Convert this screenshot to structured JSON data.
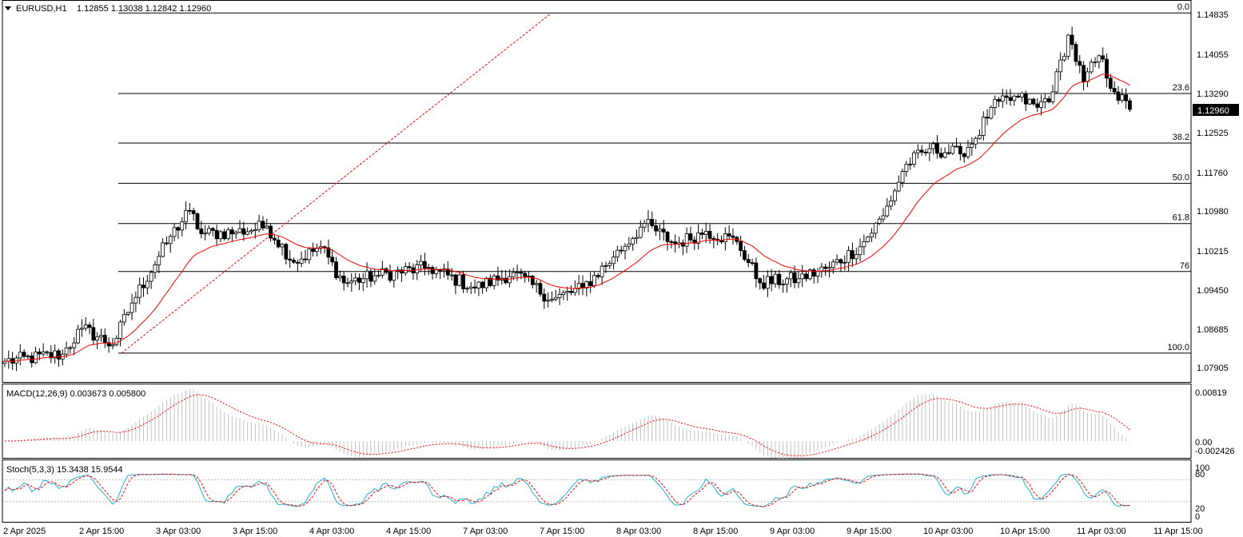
{
  "header": {
    "symbol": "EURUSD,H1",
    "ohlc": "1.12855 1.13038 1.12842 1.12960"
  },
  "price_axis": {
    "labels": [
      "1.14835",
      "1.14055",
      "1.13290",
      "1.12525",
      "1.11760",
      "1.10980",
      "1.10215",
      "1.09450",
      "1.08685",
      "1.07905"
    ],
    "current_price": "1.12960"
  },
  "fibonacci": {
    "levels": [
      {
        "label": "0.0",
        "price": 1.1483
      },
      {
        "label": "23.6",
        "price": 1.1327
      },
      {
        "label": "38.2",
        "price": 1.1231
      },
      {
        "label": "50.0",
        "price": 1.1153
      },
      {
        "label": "61.8",
        "price": 1.1075
      },
      {
        "label": "76",
        "price": 1.0982
      },
      {
        "label": "100.0",
        "price": 1.0824
      }
    ]
  },
  "macd": {
    "title": "MACD(12,26,9) 0.003673 0.005800",
    "axis_labels": [
      "0.00819",
      "0.00",
      "-0.002426"
    ]
  },
  "stochastic": {
    "title": "Stoch(5,3,3) 15.3438 15.9544",
    "axis_labels": [
      "100",
      "80",
      "20",
      "0"
    ]
  },
  "time_axis": {
    "labels": [
      "2 Apr 2025",
      "2 Apr 15:00",
      "3 Apr 03:00",
      "3 Apr 15:00",
      "4 Apr 03:00",
      "4 Apr 15:00",
      "7 Apr 03:00",
      "7 Apr 15:00",
      "8 Apr 03:00",
      "8 Apr 15:00",
      "9 Apr 03:00",
      "9 Apr 15:00",
      "10 Apr 03:00",
      "10 Apr 15:00",
      "11 Apr 03:00",
      "11 Apr 15:00"
    ]
  },
  "colors": {
    "bull_candle": "#ffffff",
    "bear_candle": "#000000",
    "moving_average": "#ff0000",
    "macd_histogram": "#c0c0c0",
    "macd_signal": "#ff0000",
    "stoch_main": "#20b2d0",
    "stoch_signal": "#ff0000",
    "fib_trend_line": "#ff0000"
  },
  "chart_data": {
    "type": "candlestick",
    "symbol": "EURUSD",
    "timeframe": "H1",
    "price_range": [
      1.0768,
      1.1505
    ],
    "close_key_points": [
      {
        "bar": 0,
        "close": 1.0808
      },
      {
        "bar": 15,
        "close": 1.0822
      },
      {
        "bar": 20,
        "close": 1.0872
      },
      {
        "bar": 28,
        "close": 1.084
      },
      {
        "bar": 33,
        "close": 1.0921
      },
      {
        "bar": 43,
        "close": 1.105
      },
      {
        "bar": 48,
        "close": 1.11
      },
      {
        "bar": 51,
        "close": 1.1055
      },
      {
        "bar": 60,
        "close": 1.1058
      },
      {
        "bar": 68,
        "close": 1.107
      },
      {
        "bar": 75,
        "close": 1.1
      },
      {
        "bar": 82,
        "close": 1.103
      },
      {
        "bar": 88,
        "close": 1.096
      },
      {
        "bar": 97,
        "close": 1.0975
      },
      {
        "bar": 110,
        "close": 1.099
      },
      {
        "bar": 122,
        "close": 1.095
      },
      {
        "bar": 132,
        "close": 1.098
      },
      {
        "bar": 142,
        "close": 1.0928
      },
      {
        "bar": 150,
        "close": 1.095
      },
      {
        "bar": 158,
        "close": 1.101
      },
      {
        "bar": 166,
        "close": 1.1075
      },
      {
        "bar": 174,
        "close": 1.1035
      },
      {
        "bar": 182,
        "close": 1.106
      },
      {
        "bar": 190,
        "close": 1.104
      },
      {
        "bar": 196,
        "close": 1.096
      },
      {
        "bar": 206,
        "close": 1.0968
      },
      {
        "bar": 214,
        "close": 1.099
      },
      {
        "bar": 222,
        "close": 1.103
      },
      {
        "bar": 228,
        "close": 1.109
      },
      {
        "bar": 234,
        "close": 1.119
      },
      {
        "bar": 240,
        "close": 1.122
      },
      {
        "bar": 248,
        "close": 1.121
      },
      {
        "bar": 252,
        "close": 1.124
      },
      {
        "bar": 256,
        "close": 1.13
      },
      {
        "bar": 263,
        "close": 1.132
      },
      {
        "bar": 268,
        "close": 1.13
      },
      {
        "bar": 272,
        "close": 1.133
      },
      {
        "bar": 276,
        "close": 1.144
      },
      {
        "bar": 280,
        "close": 1.135
      },
      {
        "bar": 284,
        "close": 1.14
      },
      {
        "bar": 288,
        "close": 1.133
      },
      {
        "bar": 292,
        "close": 1.1296
      }
    ]
  }
}
